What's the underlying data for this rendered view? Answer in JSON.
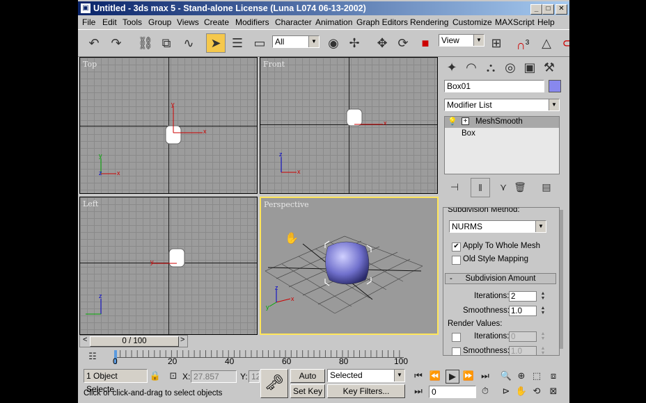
{
  "window": {
    "title": "Untitled - 3ds max 5 - Stand-alone License (Luna L074 06-13-2002)"
  },
  "window_controls": {
    "minimize": "_",
    "maximize": "□",
    "close": "✕"
  },
  "menu": [
    "File",
    "Edit",
    "Tools",
    "Group",
    "Views",
    "Create",
    "Modifiers",
    "Character",
    "Animation",
    "Graph Editors",
    "Rendering",
    "Customize",
    "MAXScript",
    "Help"
  ],
  "toolbar": {
    "selection_filter": "All",
    "coord_system": "View",
    "snap_value": "3"
  },
  "viewports": {
    "top": "Top",
    "front": "Front",
    "left": "Left",
    "perspective": "Perspective"
  },
  "axes": {
    "x": "x",
    "y": "y",
    "z": "z"
  },
  "command_panel": {
    "object_name": "Box01",
    "modifier_list": "Modifier List",
    "stack": [
      "MeshSmooth",
      "Box"
    ],
    "subdivision_method_label": "Subdivision Method:",
    "subdivision_method": "NURMS",
    "apply_to_whole_mesh": "Apply To Whole Mesh",
    "old_style_mapping": "Old Style Mapping",
    "rollout_title": "Subdivision Amount",
    "rollout_toggle": "-",
    "iterations_label": "Iterations:",
    "iterations": "2",
    "smoothness_label": "Smoothness:",
    "smoothness": "1.0",
    "render_values_label": "Render Values:",
    "render_iterations": "0",
    "render_smoothness": "1.0"
  },
  "timeline": {
    "frame_display": "0 / 100",
    "ticks": [
      "0",
      "20",
      "40",
      "60",
      "80",
      "100"
    ],
    "prev": "<",
    "next": ">"
  },
  "status": {
    "selection": "1 Object Selecte",
    "x_label": "X:",
    "x_value": "27.857",
    "y_label": "Y:",
    "y_value": "12",
    "prompt": "Click or click-and-drag to select objects",
    "auto_key": "Auto Key",
    "key_mode": "Selected",
    "set_key": "Set Key",
    "key_filters": "Key Filters...",
    "frame": "0"
  },
  "colors": {
    "title_start": "#0a246a",
    "title_end": "#a6caf0",
    "active_tool": "#f5c84c",
    "active_viewport": "#ffe65a",
    "object_color": "#8888ee"
  }
}
